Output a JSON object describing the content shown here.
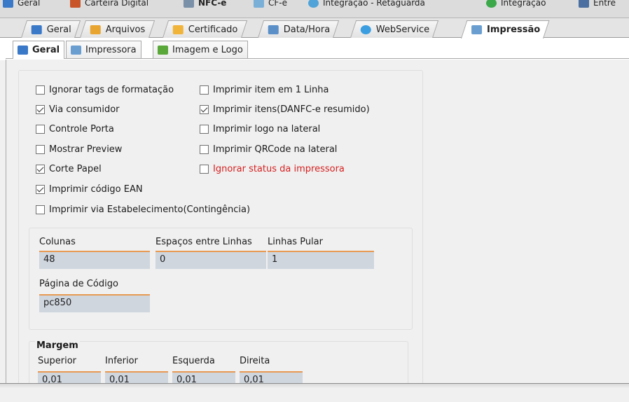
{
  "top_tabs": [
    {
      "label": "Geral",
      "icon": "blue-grid-icon"
    },
    {
      "label": "Carteira Digital",
      "icon": "wallet-icon"
    },
    {
      "label": "NFC-e",
      "icon": "nfce-icon"
    },
    {
      "label": "CF-e",
      "icon": "cfe-icon"
    },
    {
      "label": "Integração - Retaguarda",
      "icon": "globe-icon"
    },
    {
      "label": "Integração",
      "icon": "green-arrow-icon"
    },
    {
      "label": "Entre",
      "icon": "people-icon"
    }
  ],
  "second_tabs": [
    {
      "label": "Geral",
      "icon": "blue-grid-icon"
    },
    {
      "label": "Arquivos",
      "icon": "folder-icon"
    },
    {
      "label": "Certificado",
      "icon": "certificate-icon"
    },
    {
      "label": "Data/Hora",
      "icon": "calendar-icon"
    },
    {
      "label": "WebService",
      "icon": "globe-icon"
    },
    {
      "label": "Impressão",
      "icon": "printer-icon"
    }
  ],
  "third_tabs": [
    {
      "label": "Geral",
      "icon": "blue-grid-icon"
    },
    {
      "label": "Impressora",
      "icon": "printer-icon"
    },
    {
      "label": "Imagem e Logo",
      "icon": "image-icon"
    }
  ],
  "checkboxes_left": [
    {
      "label": "Ignorar tags de formatação",
      "checked": false
    },
    {
      "label": "Via consumidor",
      "checked": true
    },
    {
      "label": "Controle Porta",
      "checked": false
    },
    {
      "label": "Mostrar Preview",
      "checked": false
    },
    {
      "label": "Corte Papel",
      "checked": true
    },
    {
      "label": "Imprimir código EAN",
      "checked": true
    },
    {
      "label": "Imprimir via Estabelecimento(Contingência)",
      "checked": false
    }
  ],
  "checkboxes_right": [
    {
      "label": "Imprimir item em 1 Linha",
      "checked": false
    },
    {
      "label": "Imprimir itens(DANFC-e resumido)",
      "checked": true
    },
    {
      "label": "Imprimir logo na lateral",
      "checked": false
    },
    {
      "label": "Imprimir QRCode na lateral",
      "checked": false
    },
    {
      "label": "Ignorar status da impressora",
      "checked": false,
      "color": "#d62020"
    }
  ],
  "fields": {
    "colunas": {
      "label": "Colunas",
      "value": "48"
    },
    "espacos": {
      "label": "Espaços entre Linhas",
      "value": "0"
    },
    "linhas_pular": {
      "label": "Linhas Pular",
      "value": "1"
    },
    "pagina_codigo": {
      "label": "Página de Código",
      "value": "pc850"
    }
  },
  "margem": {
    "title": "Margem",
    "superior": {
      "label": "Superior",
      "value": "0,01"
    },
    "inferior": {
      "label": "Inferior",
      "value": "0,01"
    },
    "esquerda": {
      "label": "Esquerda",
      "value": "0,01"
    },
    "direita": {
      "label": "Direita",
      "value": "0,01"
    }
  },
  "colors": {
    "accent_underline": "#e89a52",
    "input_bg": "#cfd6de",
    "warning_text": "#d62020"
  }
}
